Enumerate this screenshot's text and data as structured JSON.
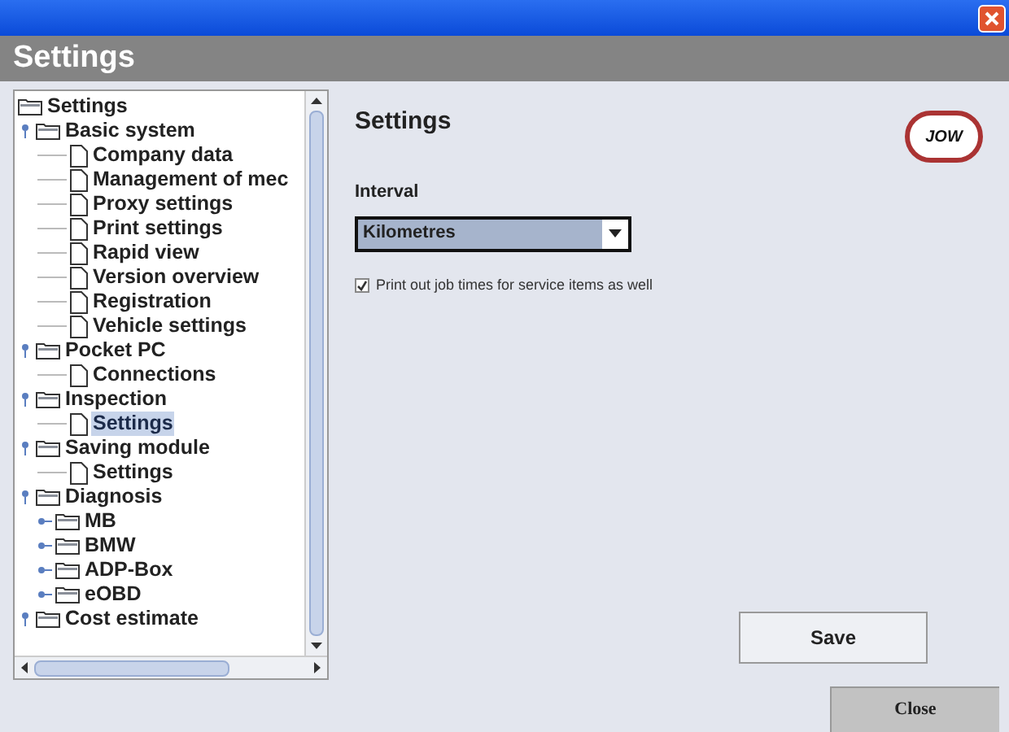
{
  "window": {
    "title": "Settings"
  },
  "tree": [
    {
      "label": "Settings",
      "kind": "root",
      "selected": false,
      "children": [
        {
          "label": "Basic system",
          "kind": "folder",
          "expanded": true,
          "selected": false,
          "children": [
            {
              "label": "Company data",
              "kind": "doc",
              "selected": false
            },
            {
              "label": "Management of mec",
              "kind": "doc",
              "selected": false
            },
            {
              "label": "Proxy settings",
              "kind": "doc",
              "selected": false
            },
            {
              "label": "Print settings",
              "kind": "doc",
              "selected": false
            },
            {
              "label": "Rapid view",
              "kind": "doc",
              "selected": false
            },
            {
              "label": "Version overview",
              "kind": "doc",
              "selected": false
            },
            {
              "label": "Registration",
              "kind": "doc",
              "selected": false
            },
            {
              "label": "Vehicle settings",
              "kind": "doc",
              "selected": false
            }
          ]
        },
        {
          "label": "Pocket PC",
          "kind": "folder",
          "expanded": true,
          "selected": false,
          "children": [
            {
              "label": "Connections",
              "kind": "doc",
              "selected": false
            }
          ]
        },
        {
          "label": "Inspection",
          "kind": "folder",
          "expanded": true,
          "selected": false,
          "children": [
            {
              "label": "Settings",
              "kind": "doc",
              "selected": true
            }
          ]
        },
        {
          "label": "Saving module",
          "kind": "folder",
          "expanded": true,
          "selected": false,
          "children": [
            {
              "label": "Settings",
              "kind": "doc",
              "selected": false
            }
          ]
        },
        {
          "label": "Diagnosis",
          "kind": "folder",
          "expanded": true,
          "selected": false,
          "children": [
            {
              "label": "MB",
              "kind": "folder",
              "expanded": false,
              "selected": false
            },
            {
              "label": "BMW",
              "kind": "folder",
              "expanded": false,
              "selected": false
            },
            {
              "label": "ADP-Box",
              "kind": "folder",
              "expanded": false,
              "selected": false
            },
            {
              "label": "eOBD",
              "kind": "folder",
              "expanded": false,
              "selected": false
            }
          ]
        },
        {
          "label": "Cost estimate",
          "kind": "folder",
          "expanded": true,
          "selected": false
        }
      ]
    }
  ],
  "panel": {
    "title": "Settings",
    "logo": "JOW",
    "interval_label": "Interval",
    "interval_value": "Kilometres",
    "checkbox": {
      "label": "Print out job times for service items as well",
      "checked": true
    },
    "save": "Save"
  },
  "close": "Close"
}
